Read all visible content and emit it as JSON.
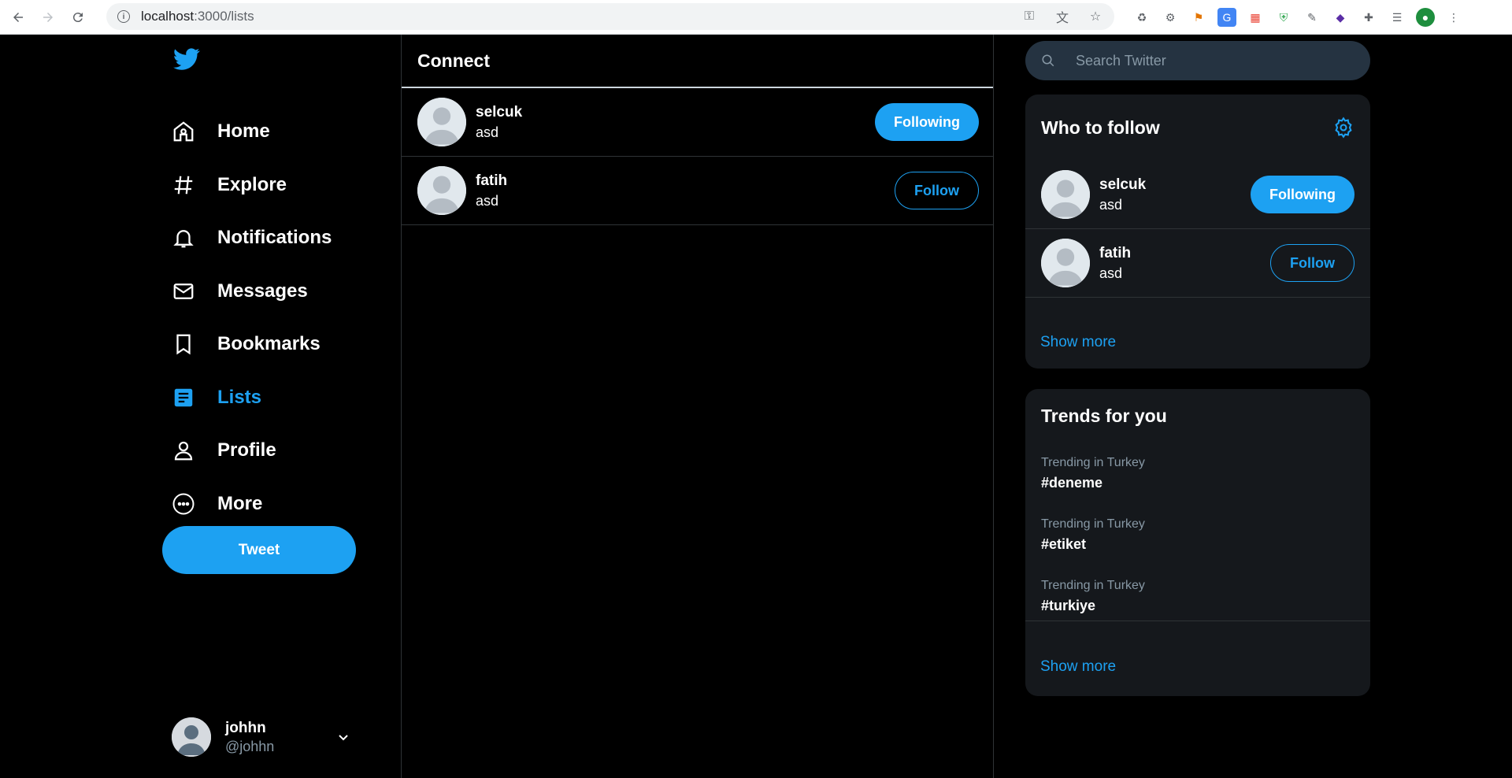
{
  "browser": {
    "url_host": "localhost",
    "url_path": ":3000/lists"
  },
  "colors": {
    "accent": "#1da1f2",
    "background": "#000000",
    "card": "#15181c",
    "muted": "#8899a6"
  },
  "sidebar": {
    "items": [
      {
        "label": "Home",
        "icon": "home-icon"
      },
      {
        "label": "Explore",
        "icon": "hashtag-icon"
      },
      {
        "label": "Notifications",
        "icon": "bell-icon"
      },
      {
        "label": "Messages",
        "icon": "mail-icon"
      },
      {
        "label": "Bookmarks",
        "icon": "bookmark-icon"
      },
      {
        "label": "Lists",
        "icon": "list-icon",
        "active": true
      },
      {
        "label": "Profile",
        "icon": "user-icon"
      },
      {
        "label": "More",
        "icon": "more-icon"
      }
    ],
    "tweet_label": "Tweet",
    "account": {
      "name": "johhn",
      "handle": "@johhn"
    }
  },
  "main": {
    "title": "Connect",
    "users": [
      {
        "name": "selcuk",
        "bio": "asd",
        "button": "Following"
      },
      {
        "name": "fatih",
        "bio": "asd",
        "button": "Follow"
      }
    ]
  },
  "right": {
    "search_placeholder": "Search Twitter",
    "who_to_follow": {
      "title": "Who to follow",
      "users": [
        {
          "name": "selcuk",
          "bio": "asd",
          "button": "Following"
        },
        {
          "name": "fatih",
          "bio": "asd",
          "button": "Follow"
        }
      ],
      "show_more": "Show more"
    },
    "trends": {
      "title": "Trends for you",
      "items": [
        {
          "context": "Trending in Turkey",
          "tag": "#deneme"
        },
        {
          "context": "Trending in Turkey",
          "tag": "#etiket"
        },
        {
          "context": "Trending in Turkey",
          "tag": "#turkiye"
        }
      ],
      "show_more": "Show more"
    }
  }
}
